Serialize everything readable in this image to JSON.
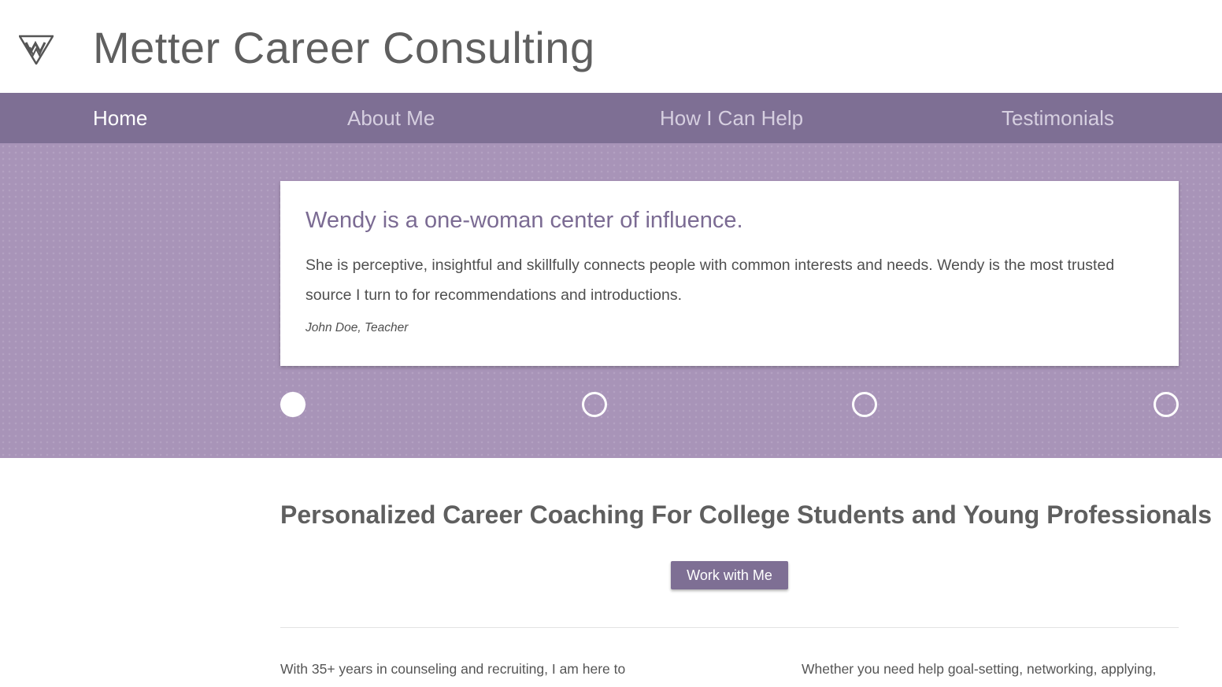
{
  "header": {
    "logo_icon": "mw-monogram-triangle-icon",
    "title": "Metter Career Consulting"
  },
  "nav": {
    "items": [
      {
        "label": "Home",
        "active": true
      },
      {
        "label": "About Me",
        "active": false
      },
      {
        "label": "How I Can Help",
        "active": false
      },
      {
        "label": "Testimonials",
        "active": false
      }
    ]
  },
  "hero": {
    "quote_title": "Wendy is a one-woman center of influence.",
    "quote_body": "She is perceptive, insightful and skillfully connects people with common interests and needs. Wendy is the most trusted source I turn to for recommendations and introductions.",
    "quote_author": "John Doe, Teacher",
    "slides_total": 4,
    "active_slide": 1
  },
  "main": {
    "tagline": "Personalized Career Coaching For College Students and Young Professionals",
    "cta_label": "Work with Me",
    "col_left_text": "With 35+ years in counseling and recruiting, I am here to",
    "col_right_text": "Whether you need help goal-setting, networking, applying,"
  },
  "colors": {
    "accent": "#7e6f94",
    "hero_bg": "#a894b8",
    "quote_title": "#7b6b93",
    "text": "#5f5f5f"
  }
}
